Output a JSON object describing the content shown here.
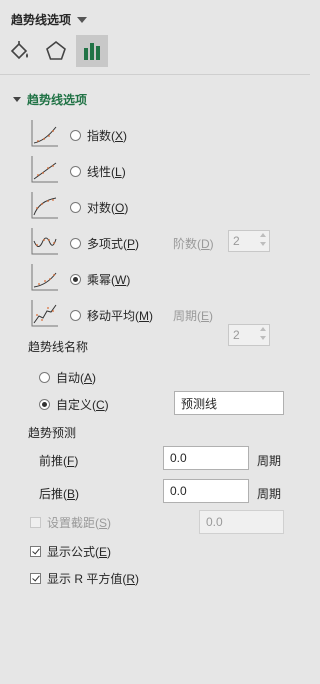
{
  "pane": {
    "title": "趋势线选项"
  },
  "tabs": [
    {
      "name": "fill-line",
      "icon": "paint-bucket-icon"
    },
    {
      "name": "effects",
      "icon": "pentagon-icon"
    },
    {
      "name": "options",
      "icon": "bar-chart-icon",
      "active": true
    }
  ],
  "section": {
    "title": "趋势线选项"
  },
  "types": [
    {
      "label": "指数(",
      "key": "X",
      "suffix": ")",
      "selected": false
    },
    {
      "label": "线性(",
      "key": "L",
      "suffix": ")",
      "selected": false
    },
    {
      "label": "对数(",
      "key": "O",
      "suffix": ")",
      "selected": false
    },
    {
      "label": "多项式(",
      "key": "P",
      "suffix": ")",
      "selected": false
    },
    {
      "label": "乘幂(",
      "key": "W",
      "suffix": ")",
      "selected": true
    },
    {
      "label": "移动平均(",
      "key": "M",
      "suffix": ")",
      "selected": false
    }
  ],
  "order": {
    "label": "阶数(",
    "key": "D",
    "suffix": ")",
    "value": "2"
  },
  "period": {
    "label": "周期(",
    "key": "E",
    "suffix": ")",
    "value": "2"
  },
  "name_group": {
    "title": "趋势线名称",
    "auto": {
      "label": "自动(",
      "key": "A",
      "suffix": ")",
      "selected": false
    },
    "custom": {
      "label": "自定义(",
      "key": "C",
      "suffix": ")",
      "selected": true,
      "value": "预测线"
    }
  },
  "forecast": {
    "title": "趋势预测",
    "forward": {
      "label": "前推(",
      "key": "F",
      "suffix": ")",
      "value": "0.0",
      "unit": "周期"
    },
    "backward": {
      "label": "后推(",
      "key": "B",
      "suffix": ")",
      "value": "0.0",
      "unit": "周期"
    }
  },
  "intercept": {
    "label": "设置截距(",
    "key": "S",
    "suffix": ")",
    "value": "0.0",
    "checked": false,
    "disabled": true
  },
  "show_equation": {
    "label": "显示公式(",
    "key": "E",
    "suffix": ")",
    "checked": true
  },
  "show_r2": {
    "label": "显示 R 平方值(",
    "key": "R",
    "suffix": ")",
    "checked": true
  }
}
